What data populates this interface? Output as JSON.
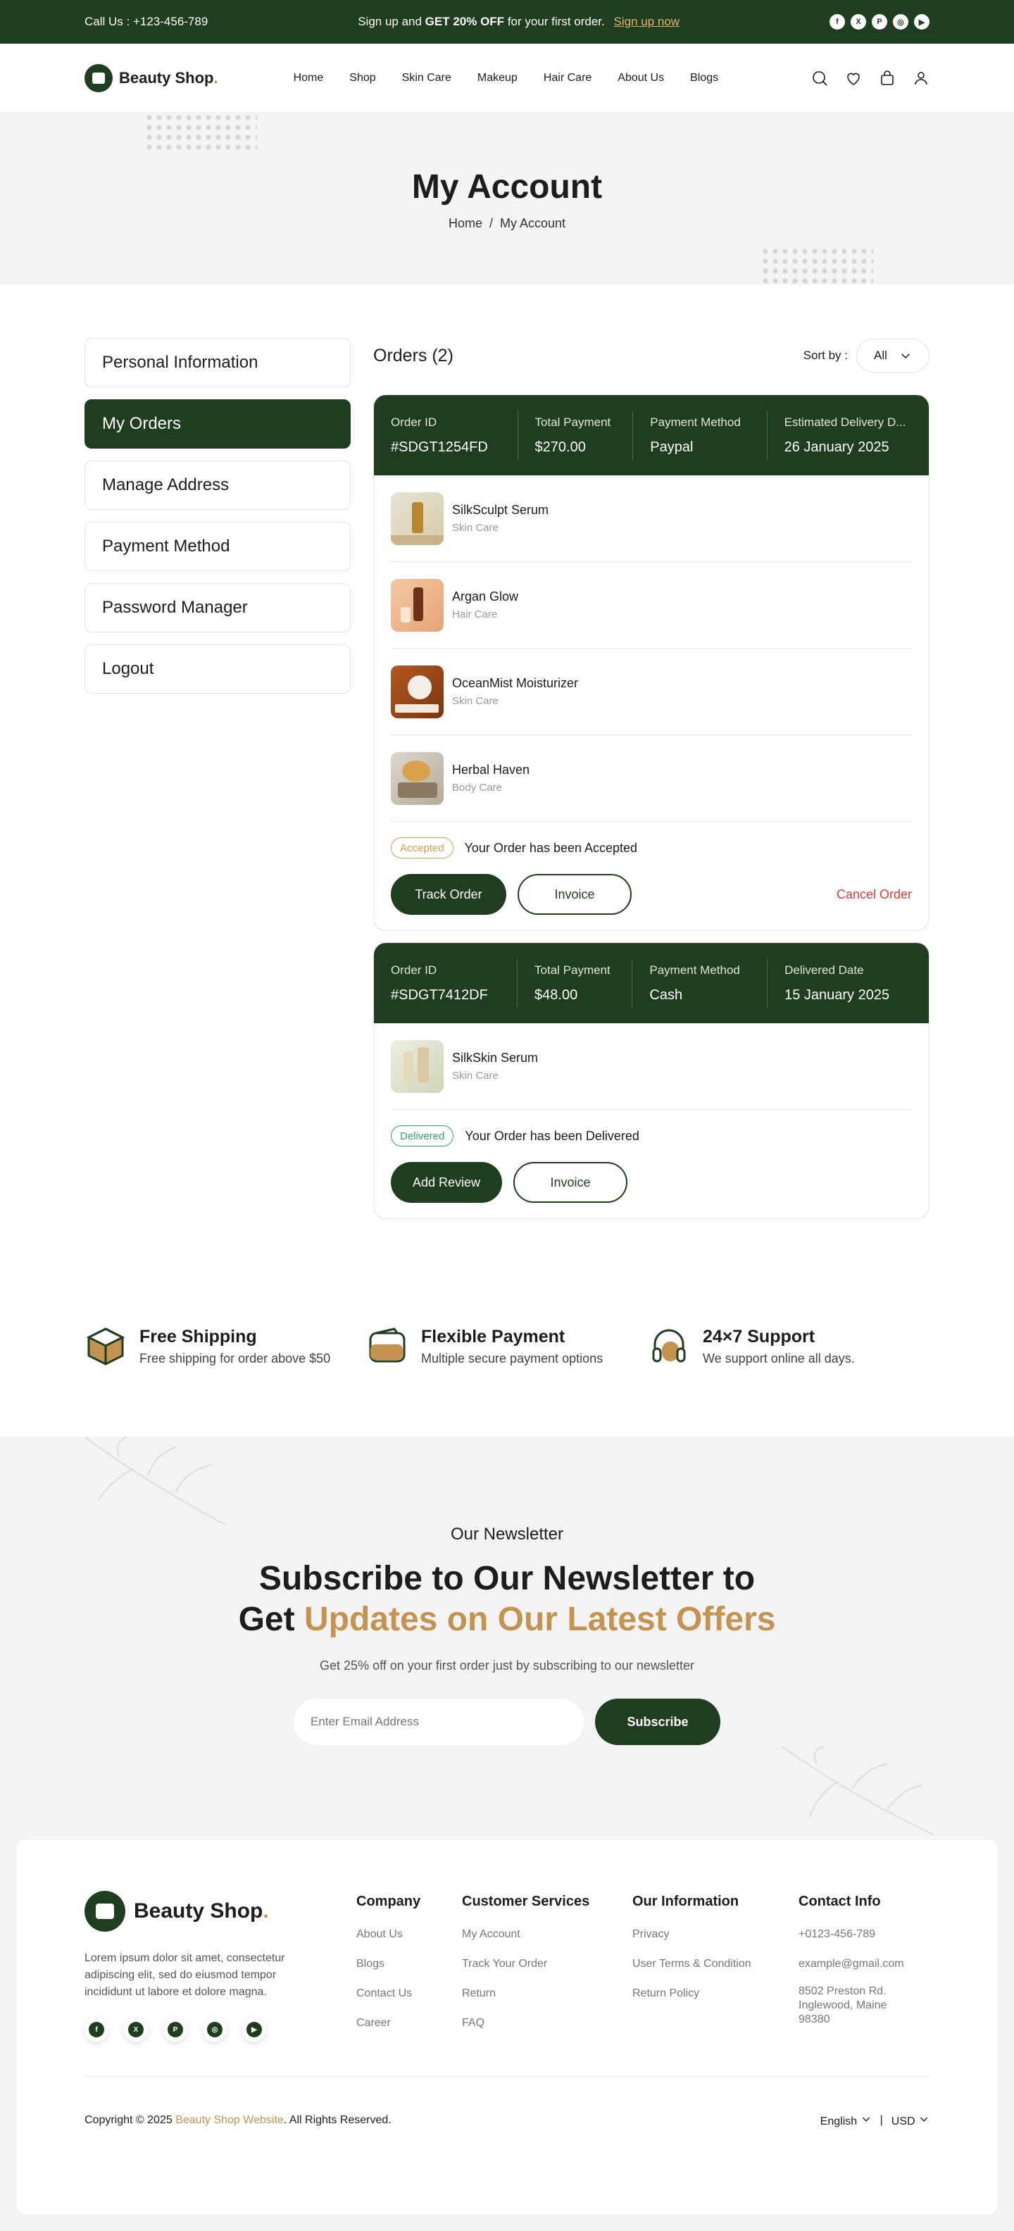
{
  "topbar": {
    "call": "Call Us :  +123-456-789",
    "promo_pre": "Sign up and ",
    "promo_bold": "GET 20% OFF",
    "promo_post": " for your first order.",
    "signup": "Sign up now",
    "social": [
      "facebook-icon",
      "x-icon",
      "pinterest-icon",
      "instagram-icon",
      "youtube-icon"
    ]
  },
  "header": {
    "brand": "Beauty Shop",
    "brand_dot": ".",
    "nav": [
      "Home",
      "Shop",
      "Skin Care",
      "Makeup",
      "Hair Care",
      "About Us",
      "Blogs"
    ]
  },
  "hero": {
    "title": "My Account",
    "crumb_home": "Home",
    "crumb_sep": "/",
    "crumb_current": "My Account"
  },
  "sidebar": {
    "items": [
      "Personal Information",
      "My Orders",
      "Manage Address",
      "Payment Method",
      "Password Manager",
      "Logout"
    ],
    "active": "My Orders"
  },
  "orders": {
    "title": "Orders (2)",
    "sort_label": "Sort by :",
    "sort_value": "All",
    "list": [
      {
        "cols": [
          {
            "label": "Order ID",
            "value": "#SDGT1254FD"
          },
          {
            "label": "Total Payment",
            "value": "$270.00"
          },
          {
            "label": "Payment Method",
            "value": "Paypal"
          },
          {
            "label": "Estimated Delivery D...",
            "value": "26 January 2025"
          }
        ],
        "products": [
          {
            "name": "SilkSculpt Serum",
            "cat": "Skin Care"
          },
          {
            "name": "Argan Glow",
            "cat": "Hair Care"
          },
          {
            "name": "OceanMist Moisturizer",
            "cat": "Skin Care"
          },
          {
            "name": "Herbal Haven",
            "cat": "Body Care"
          }
        ],
        "badge": "Accepted",
        "status": "Your Order has been Accepted",
        "btn_primary": "Track Order",
        "btn_secondary": "Invoice",
        "cancel": "Cancel Order"
      },
      {
        "cols": [
          {
            "label": "Order ID",
            "value": "#SDGT7412DF"
          },
          {
            "label": "Total Payment",
            "value": "$48.00"
          },
          {
            "label": "Payment Method",
            "value": "Cash"
          },
          {
            "label": "Delivered Date",
            "value": "15 January 2025"
          }
        ],
        "products": [
          {
            "name": "SilkSkin Serum",
            "cat": "Skin Care"
          }
        ],
        "badge": "Delivered",
        "status": "Your Order has been Delivered",
        "btn_primary": "Add Review",
        "btn_secondary": "Invoice"
      }
    ]
  },
  "features": [
    {
      "title": "Free Shipping",
      "desc": "Free shipping for order above $50"
    },
    {
      "title": "Flexible Payment",
      "desc": "Multiple secure payment options"
    },
    {
      "title": "24×7 Support",
      "desc": "We support online all days."
    }
  ],
  "newsletter": {
    "pre": "Our Newsletter",
    "h1": "Subscribe to Our Newsletter to",
    "h2_pre": "Get ",
    "h2_accent": "Updates on Our Latest Offers",
    "desc": "Get 25% off on your first order just by subscribing to our newsletter",
    "placeholder": "Enter Email Address",
    "button": "Subscribe"
  },
  "footer": {
    "brand": "Beauty Shop",
    "brand_dot": ".",
    "about": "Lorem ipsum dolor sit amet, consectetur adipiscing elit, sed do eiusmod tempor incididunt ut labore et dolore magna.",
    "columns": [
      {
        "title": "Company",
        "links": [
          "About Us",
          "Blogs",
          "Contact Us",
          "Career"
        ]
      },
      {
        "title": "Customer Services",
        "links": [
          "My Account",
          "Track Your Order",
          "Return",
          "FAQ"
        ]
      },
      {
        "title": "Our Information",
        "links": [
          "Privacy",
          "User Terms & Condition",
          "Return Policy"
        ]
      },
      {
        "title": "Contact Info",
        "links": [
          "+0123-456-789",
          "example@gmail.com",
          "8502 Preston Rd. Inglewood, Maine 98380"
        ]
      }
    ],
    "copy_pre": "Copyright © 2025 ",
    "copy_link": "Beauty Shop Website",
    "copy_post": ". All Rights Reserved.",
    "lang": "English",
    "sep": "|",
    "currency": "USD"
  },
  "colors": {
    "brand": "#1f3d1f",
    "accent": "#c49350",
    "danger": "#e53935",
    "success": "#2ea86a",
    "warning": "#e79a3f"
  }
}
